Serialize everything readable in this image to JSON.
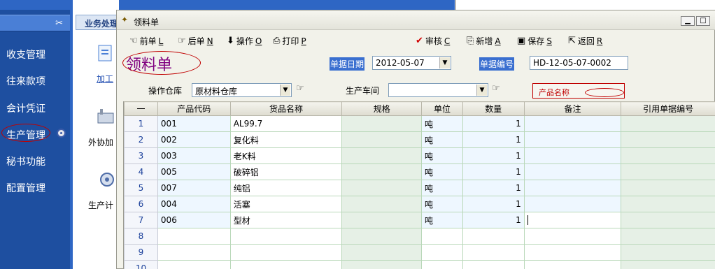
{
  "sidebar": {
    "items": [
      {
        "label": "收支管理"
      },
      {
        "label": "往来款项"
      },
      {
        "label": "会计凭证"
      },
      {
        "label": "生产管理"
      },
      {
        "label": "秘书功能"
      },
      {
        "label": "配置管理"
      }
    ]
  },
  "business_panel": {
    "tab": "业务处理",
    "items": [
      {
        "label": "加工",
        "icon": "document-icon"
      },
      {
        "label": "外协加",
        "icon": "factory-icon"
      },
      {
        "label": "生产计",
        "icon": "gear-icon"
      }
    ]
  },
  "window": {
    "title": "领料单"
  },
  "toolbar": {
    "prev": {
      "text": "前单",
      "key": "L"
    },
    "next": {
      "text": "后单",
      "key": "N"
    },
    "operate": {
      "text": "操作",
      "key": "O"
    },
    "print": {
      "text": "打印",
      "key": "P"
    },
    "approve": {
      "text": "审核",
      "key": "C"
    },
    "add": {
      "text": "新增",
      "key": "A"
    },
    "save": {
      "text": "保存",
      "key": "S"
    },
    "back": {
      "text": "返回",
      "key": "R"
    }
  },
  "form": {
    "title": "领料单",
    "date_label": "单据日期",
    "date_value": "2012-05-07",
    "number_label": "单据编号",
    "number_value": "HD-12-05-07-0002",
    "warehouse_label": "操作仓库",
    "warehouse_value": "原材料仓库",
    "workshop_label": "生产车间",
    "workshop_value": "",
    "product_name_label": "产品名称"
  },
  "grid": {
    "headers": [
      "一",
      "产品代码",
      "货品名称",
      "规格",
      "单位",
      "数量",
      "备注",
      "引用单据编号"
    ],
    "rows": [
      {
        "n": "1",
        "code": "001",
        "name": "AL99.7",
        "spec": "",
        "unit": "吨",
        "qty": "1",
        "note": "",
        "ref": ""
      },
      {
        "n": "2",
        "code": "002",
        "name": "复化料",
        "spec": "",
        "unit": "吨",
        "qty": "1",
        "note": "",
        "ref": ""
      },
      {
        "n": "3",
        "code": "003",
        "name": "老K料",
        "spec": "",
        "unit": "吨",
        "qty": "1",
        "note": "",
        "ref": ""
      },
      {
        "n": "4",
        "code": "005",
        "name": "破碎铝",
        "spec": "",
        "unit": "吨",
        "qty": "1",
        "note": "",
        "ref": ""
      },
      {
        "n": "5",
        "code": "007",
        "name": "纯铝",
        "spec": "",
        "unit": "吨",
        "qty": "1",
        "note": "",
        "ref": ""
      },
      {
        "n": "6",
        "code": "004",
        "name": "活塞",
        "spec": "",
        "unit": "吨",
        "qty": "1",
        "note": "",
        "ref": ""
      },
      {
        "n": "7",
        "code": "006",
        "name": "型材",
        "spec": "",
        "unit": "吨",
        "qty": "1",
        "note": "",
        "ref": ""
      },
      {
        "n": "8",
        "code": "",
        "name": "",
        "spec": "",
        "unit": "",
        "qty": "",
        "note": "",
        "ref": ""
      },
      {
        "n": "9",
        "code": "",
        "name": "",
        "spec": "",
        "unit": "",
        "qty": "",
        "note": "",
        "ref": ""
      },
      {
        "n": "10",
        "code": "",
        "name": "",
        "spec": "",
        "unit": "",
        "qty": "",
        "note": "",
        "ref": ""
      }
    ]
  },
  "colors": {
    "sidebar_bg": "#1e4fa0",
    "title_purple": "#800080",
    "highlight_blue": "#3a6fd0",
    "annotation_red": "#c00000"
  }
}
